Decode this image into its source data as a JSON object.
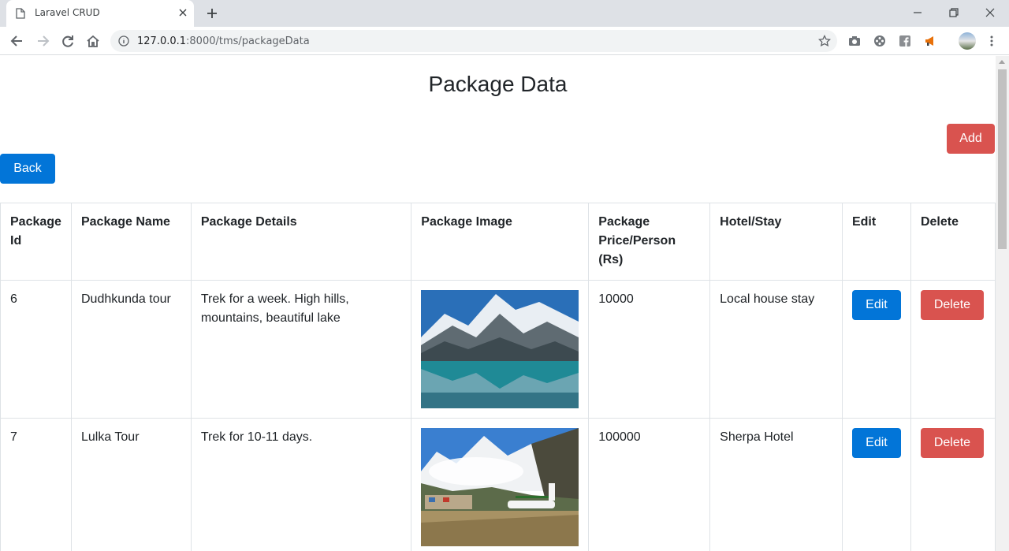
{
  "browser": {
    "tab_title": "Laravel CRUD",
    "url_host": "127.0.0.1",
    "url_path": ":8000/tms/packageData"
  },
  "page": {
    "title": "Package Data",
    "add_label": "Add",
    "back_label": "Back"
  },
  "table": {
    "headers": [
      "Package Id",
      "Package Name",
      "Package Details",
      "Package Image",
      "Package Price/Person (Rs)",
      "Hotel/Stay",
      "Edit",
      "Delete"
    ],
    "rows": [
      {
        "id": "6",
        "name": "Dudhkunda tour",
        "details": "Trek for a week. High hills, mountains, beautiful lake",
        "image": "mountain-lake-photo",
        "price": "10000",
        "hotel": "Local house stay",
        "edit": "Edit",
        "delete": "Delete"
      },
      {
        "id": "7",
        "name": "Lulka Tour",
        "details": "Trek for 10-11 days.",
        "image": "mountain-airstrip-photo",
        "price": "100000",
        "hotel": "Sherpa Hotel",
        "edit": "Edit",
        "delete": "Delete"
      }
    ]
  },
  "colors": {
    "primary": "#0275d8",
    "danger": "#d9534f"
  }
}
